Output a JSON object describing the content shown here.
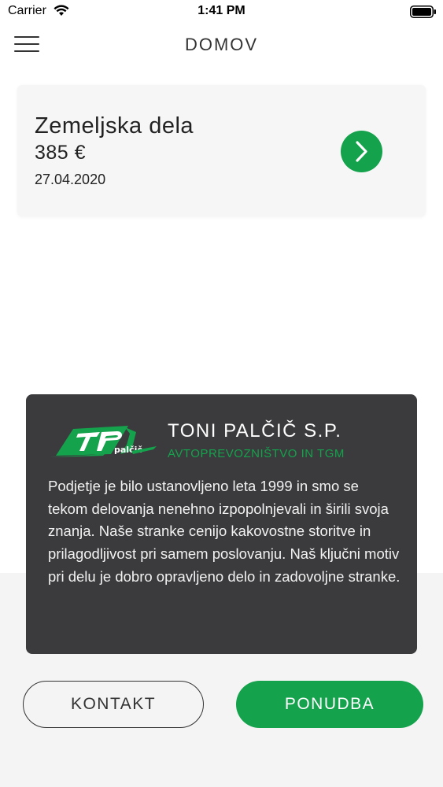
{
  "status_bar": {
    "carrier": "Carrier",
    "time": "1:41 PM"
  },
  "nav": {
    "title": "DOMOV",
    "menu_icon": "hamburger-icon"
  },
  "job_card": {
    "title": "Zemeljska dela",
    "price": "385 €",
    "date": "27.04.2020",
    "open_icon": "chevron-right-icon"
  },
  "company": {
    "name": "TONI PALČIČ S.P.",
    "subtitle": "AVTOPREVOZNIŠTVO IN TGM",
    "description": "Podjetje je bilo ustanovljeno leta 1999 in smo se tekom delovanja nenehno izpopolnjevali in širili svoja znanja. Naše stranke cenijo kakovostne storitve in prilagodljivost pri samem poslovanju. Naš ključni motiv pri delu je dobro opravljeno delo in zadovoljne stranke.",
    "logo_text": "palčič"
  },
  "actions": {
    "contact_label": "KONTAKT",
    "offer_label": "PONUDBA"
  },
  "colors": {
    "accent": "#14a24c",
    "panel": "#3b3b3d"
  }
}
